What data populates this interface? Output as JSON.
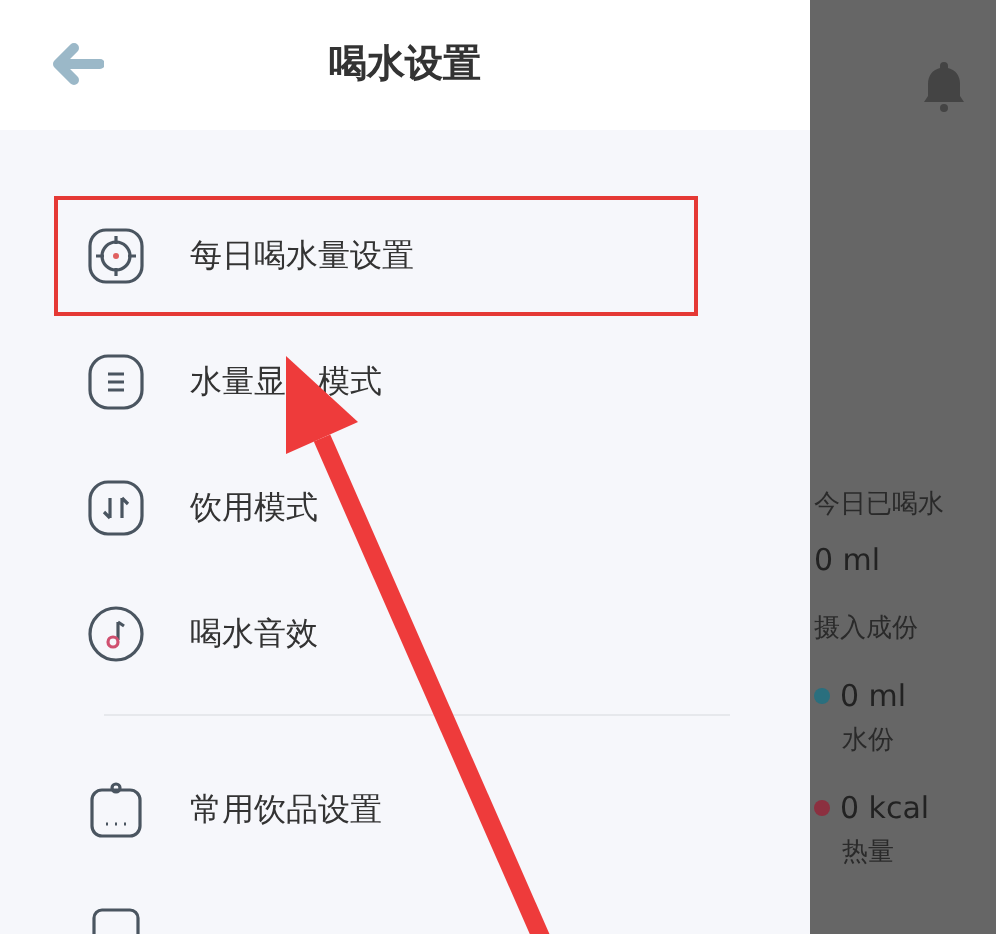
{
  "header": {
    "title": "喝水设置"
  },
  "menu_groups": [
    [
      {
        "kind": "target",
        "label": "每日喝水量设置",
        "highlighted": true
      },
      {
        "kind": "list",
        "label_parts": [
          "水量显",
          "模式"
        ],
        "highlighted": false
      },
      {
        "kind": "swap",
        "label": "饮用模式",
        "highlighted": false
      },
      {
        "kind": "music",
        "label": "喝水音效",
        "highlighted": false
      }
    ],
    [
      {
        "kind": "bottle",
        "label": "常用饮品设置",
        "highlighted": false
      },
      {
        "kind": "glass",
        "highlighted": false
      }
    ]
  ],
  "background_panel": {
    "today_label": "今日已喝水",
    "today_value": "0 ml",
    "intake_label": "摄入成份",
    "intake": [
      {
        "value": "0 ml",
        "label": "水份",
        "color": "#2a6f7e"
      },
      {
        "value": "0 kcal",
        "label": "热量",
        "color": "#8c3040"
      }
    ]
  }
}
